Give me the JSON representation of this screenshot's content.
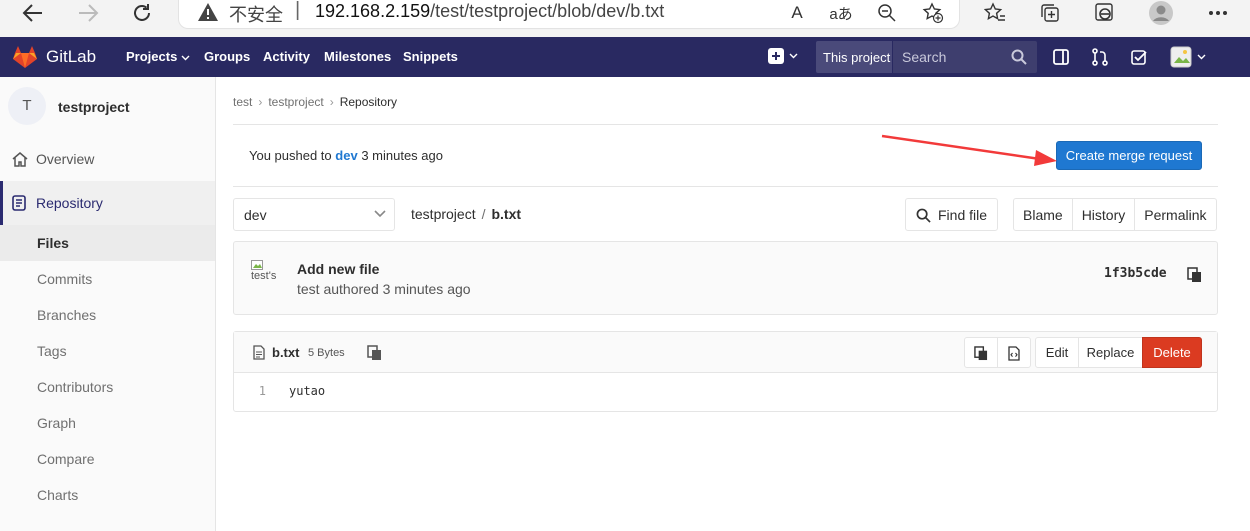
{
  "browser": {
    "insecure_label": "不安全",
    "separator": "|",
    "url_host": "192.168.2.159",
    "url_path": "/test/testproject/blob/dev/b.txt",
    "read_aloud_glyph": "A",
    "translate_glyph": "aあ"
  },
  "header": {
    "brand": "GitLab",
    "nav": [
      "Projects",
      "Groups",
      "Activity",
      "Milestones",
      "Snippets"
    ],
    "search_scope": "This project",
    "search_placeholder": "Search",
    "colors": {
      "background": "#292961",
      "accent": "#fc6d26"
    }
  },
  "sidebar": {
    "avatar_letter": "T",
    "project_name": "testproject",
    "overview": "Overview",
    "repository": "Repository",
    "items": [
      "Files",
      "Commits",
      "Branches",
      "Tags",
      "Contributors",
      "Graph",
      "Compare",
      "Charts"
    ],
    "active_item": "Files"
  },
  "breadcrumb": {
    "items": [
      "test",
      "testproject",
      "Repository"
    ],
    "separator": "›"
  },
  "push_notice": {
    "prefix": "You pushed to",
    "branch": "dev",
    "suffix": "3 minutes ago",
    "button": "Create merge request"
  },
  "tree": {
    "branch": "dev",
    "project": "testproject",
    "separator": "/",
    "file": "b.txt",
    "find_file": "Find file",
    "buttons": [
      "Blame",
      "History",
      "Permalink"
    ]
  },
  "commit": {
    "avatar_alt": "test's",
    "title": "Add new file",
    "author_line": "test authored 3 minutes ago",
    "sha": "1f3b5cde"
  },
  "file": {
    "name": "b.txt",
    "size": "5 Bytes",
    "actions": [
      "Edit",
      "Replace",
      "Delete"
    ],
    "delete_color": "#db3b21",
    "lines": [
      {
        "number": "1",
        "text": "yutao"
      }
    ]
  },
  "annotation": {
    "arrow_color": "#f23a3a"
  }
}
